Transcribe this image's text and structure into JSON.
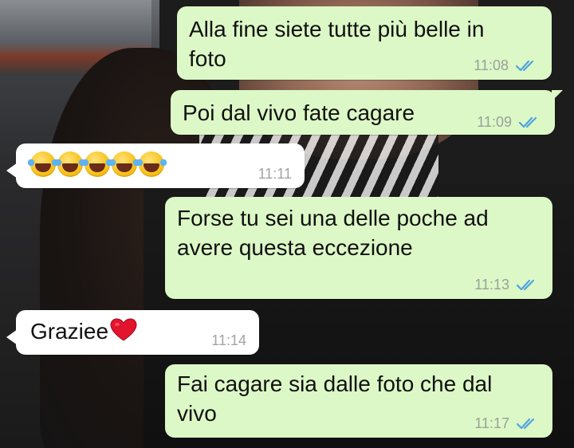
{
  "messages": [
    {
      "dir": "out",
      "lines": [
        "Alla fine siete tutte più belle in",
        "foto"
      ],
      "time": "11:08"
    },
    {
      "dir": "out",
      "lines": [
        "Poi dal vivo fate cagare"
      ],
      "time": "11:09"
    },
    {
      "dir": "in",
      "emoji": "face-with-tears-of-joy",
      "emoji_count": 5,
      "time": "11:11"
    },
    {
      "dir": "out",
      "lines": [
        "Forse tu sei una delle poche ad",
        "avere questa eccezione"
      ],
      "time": "11:13"
    },
    {
      "dir": "in",
      "text": "Graziee",
      "emoji": "red-heart",
      "time": "11:14"
    },
    {
      "dir": "out",
      "lines": [
        "Fai cagare sia dalle foto che dal",
        "vivo"
      ],
      "time": "11:17"
    }
  ],
  "colors": {
    "outgoing_bubble": "#dcf8c6",
    "incoming_bubble": "#ffffff",
    "read_ticks": "#4fa3e0"
  }
}
